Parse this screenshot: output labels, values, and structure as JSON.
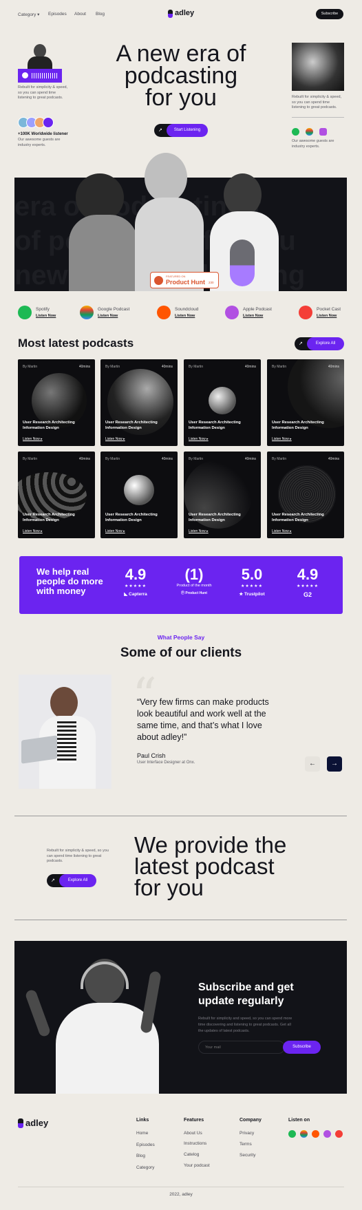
{
  "nav": {
    "category": "Category",
    "episodes": "Episodes",
    "about": "About",
    "blog": "Blog",
    "logo": "adley",
    "subscribe": "Subscribe"
  },
  "hero": {
    "title_l1": "A new era of",
    "title_l2": "podcasting",
    "title_l3": "for you",
    "cta": "Start Listening",
    "left_text": "Rebuilt for simplicity & speed, so you can spend time listening to great podcasts.",
    "listeners": "+100K Worldwide listener",
    "listeners_sub": "Our awesome guests are industry experts.",
    "right_text": "Rebuilt for simplicity & speed, so you can spend time listening to great podcasts.",
    "right_sub": "Our awesome guests are industry experts.",
    "ph_featured": "FEATURED ON",
    "ph_name": "Product Hunt",
    "ph_count": "230"
  },
  "platforms": [
    {
      "name": "Spotify",
      "link": "Listen Now"
    },
    {
      "name": "Google Podcast",
      "link": "Listen Now"
    },
    {
      "name": "Soundcloud",
      "link": "Listen Now"
    },
    {
      "name": "Apple Podcast",
      "link": "Listen Now"
    },
    {
      "name": "Pocket Cast",
      "link": "Listen Now"
    }
  ],
  "latest": {
    "heading": "Most latest podcasts",
    "explore": "Explore All"
  },
  "cards": [
    {
      "by": "By Martin",
      "mins": "40mins",
      "title": "User Research Architecting Information Design",
      "link": "Listen Now"
    },
    {
      "by": "By Martin",
      "mins": "40mins",
      "title": "User Research Architecting Information Design",
      "link": "Listen Now"
    },
    {
      "by": "By Martin",
      "mins": "40mins",
      "title": "User Research Architecting Information Design",
      "link": "Listen Now"
    },
    {
      "by": "By Martin",
      "mins": "40mins",
      "title": "User Research Architecting Information Design",
      "link": "Listen Now"
    },
    {
      "by": "By Martin",
      "mins": "40mins",
      "title": "User Research Architecting Information Design",
      "link": "Listen Now"
    },
    {
      "by": "By Martin",
      "mins": "40mins",
      "title": "User Research Architecting Information Design",
      "link": "Listen Now"
    },
    {
      "by": "By Martin",
      "mins": "40mins",
      "title": "User Research Architecting Information Design",
      "link": "Listen Now"
    },
    {
      "by": "By Martin",
      "mins": "40mins",
      "title": "User Research Architecting Information Design",
      "link": "Listen Now"
    }
  ],
  "ratings": {
    "headline": "We help real people do more with money",
    "items": [
      {
        "value": "4.9",
        "stars": "★★★★★",
        "brand": "Capterra"
      },
      {
        "value": "1",
        "stars": "Product of the month",
        "brand": "Product Hunt"
      },
      {
        "value": "5.0",
        "stars": "★★★★★",
        "brand": "Trustpilot"
      },
      {
        "value": "4.9",
        "stars": "★★★★★",
        "brand": "G2"
      }
    ]
  },
  "testimonial": {
    "eyebrow": "What People Say",
    "heading": "Some of our clients",
    "quote": "“Very few firms can make products look beautiful and work well at the same time, and that’s what I love about adley!”",
    "name": "Paul Crish",
    "role": "User Interface Designer at Onx."
  },
  "provide": {
    "text": "Rebuilt for simplicity & speed, so you can spend time listening to great podcasts.",
    "cta": "Explore All",
    "title_l1": "We provide the",
    "title_l2": "latest podcast",
    "title_l3": "for you"
  },
  "subscribe": {
    "title_l1": "Subscribe and get",
    "title_l2": "update regularly",
    "text": "Rebuilt for simplicity and speed, so you can spend more time discovering and listening to great podcasts. Get all the updates of latest podcasts.",
    "placeholder": "Your mail",
    "button": "Subscribe"
  },
  "footer": {
    "logo": "adley",
    "links_h": "Links",
    "links": [
      "Home",
      "Episodes",
      "Blog",
      "Category"
    ],
    "features_h": "Features",
    "features": [
      "About Us",
      "Instructions",
      "Catelog",
      "Your podcast"
    ],
    "company_h": "Company",
    "company": [
      "Privacy",
      "Terms",
      "Security"
    ],
    "listen_h": "Listen on",
    "copyright": "2022, adley"
  },
  "colors": {
    "accent": "#6b24f0",
    "dark": "#121318",
    "bg": "#eeebe5"
  }
}
